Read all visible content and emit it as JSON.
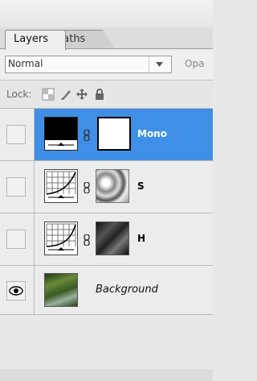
{
  "tabs": [
    {
      "label": "Layers",
      "active": true
    },
    {
      "label": "Paths",
      "active": false
    }
  ],
  "blend_mode": {
    "value": "Normal",
    "opacity_label": "Opa"
  },
  "lock": {
    "label": "Lock:"
  },
  "layers": [
    {
      "name": "Mono",
      "selected": true,
      "visible": false,
      "type": "gradient-map-adjustment",
      "mask": "white"
    },
    {
      "name": "S",
      "selected": false,
      "visible": false,
      "type": "curves-adjustment",
      "mask": "grayscale-texture"
    },
    {
      "name": "H",
      "selected": false,
      "visible": false,
      "type": "curves-adjustment",
      "mask": "forest-grayscale"
    },
    {
      "name": "Background",
      "selected": false,
      "visible": true,
      "type": "image",
      "italic": true
    }
  ],
  "colors": {
    "selection": "#3f8fe6"
  }
}
